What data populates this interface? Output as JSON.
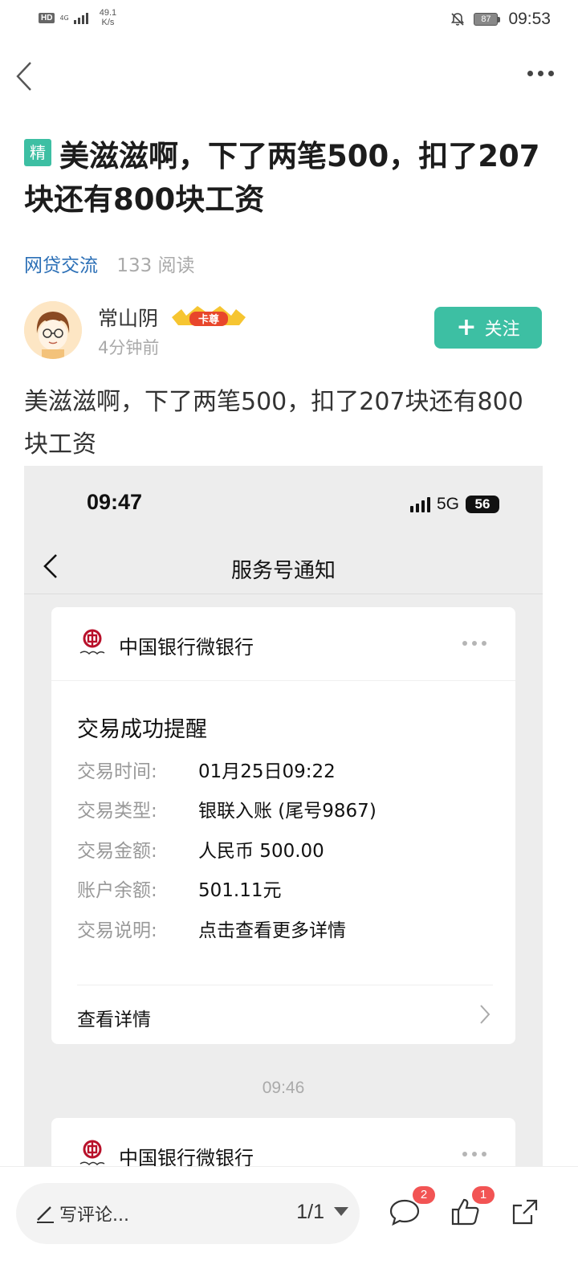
{
  "status_bar": {
    "hd": "HD",
    "network": "4G",
    "speed_value": "49.1",
    "speed_unit": "K/s",
    "battery": "87",
    "time": "09:53"
  },
  "post": {
    "tag": "精",
    "title": "美滋滋啊，下了两笔500，扣了207块还有800块工资",
    "forum": "网贷交流",
    "reads": "133 阅读",
    "body": "美滋滋啊，下了两笔500，扣了207块还有800块工资"
  },
  "author": {
    "name": "常山阴",
    "badge": "卡尊",
    "time": "4分钟前",
    "follow_label": "关注"
  },
  "screenshot": {
    "time": "09:47",
    "network": "5G",
    "battery": "56",
    "nav_title": "服务号通知",
    "card1": {
      "bank": "中国银行微银行",
      "notice_title": "交易成功提醒",
      "rows": [
        {
          "label": "交易时间:",
          "value": "01月25日09:22"
        },
        {
          "label": "交易类型:",
          "value": "银联入账 (尾号9867)"
        },
        {
          "label": "交易金额:",
          "value": "人民币 500.00"
        },
        {
          "label": "账户余额:",
          "value": "501.11元"
        },
        {
          "label": "交易说明:",
          "value": "点击查看更多详情"
        }
      ],
      "detail_link": "查看详情"
    },
    "separator_time": "09:46",
    "card2": {
      "bank": "中国银行微银行"
    }
  },
  "bottom_bar": {
    "comment_placeholder": "写评论...",
    "page": "1/1",
    "comment_count": "2",
    "like_count": "1"
  },
  "colors": {
    "accent": "#3dbfa3",
    "forum_link": "#2b6fb6",
    "badge_red": "#f25454"
  }
}
